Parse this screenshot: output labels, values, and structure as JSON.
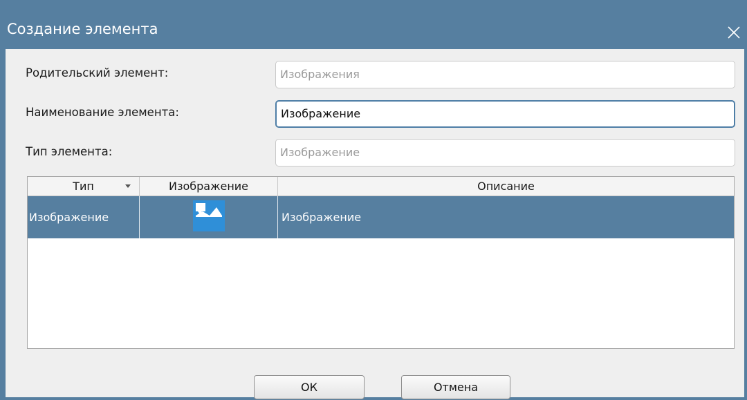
{
  "dialog": {
    "title": "Создание элемента"
  },
  "form": {
    "parent_label": "Родительский элемент:",
    "parent_value": "Изображения",
    "name_label": "Наименование элемента:",
    "name_value": "Изображение",
    "type_label": "Тип элемента:",
    "type_value": "Изображение"
  },
  "table": {
    "columns": [
      "Тип",
      "Изображение",
      "Описание"
    ],
    "rows": [
      {
        "type": "Изображение",
        "image_icon": "image-icon",
        "description": "Изображение"
      }
    ]
  },
  "buttons": {
    "ok": "ОК",
    "cancel": "Отмена"
  },
  "colors": {
    "titlebar": "#567fa0",
    "selection": "#567fa0",
    "icon": "#2f8fd8"
  }
}
